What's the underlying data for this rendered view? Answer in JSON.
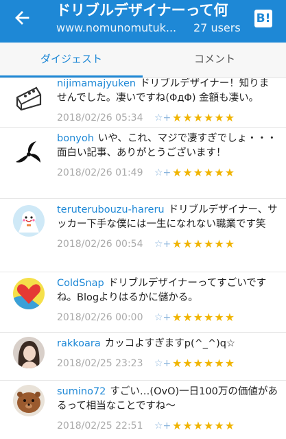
{
  "header": {
    "title": "ドリブルデザイナーって何",
    "domain": "www.nomunomutuk...",
    "users": "27 users",
    "logo": "B!"
  },
  "tabs": [
    {
      "label": "ダイジェスト",
      "active": true
    },
    {
      "label": "コメント",
      "active": false
    }
  ],
  "colors": {
    "accent": "#1e88d6",
    "star": "#f0b400"
  },
  "comments": [
    {
      "user": "nijimamajyuken",
      "text": "ドリブルデザイナー！知りませんでした。凄いですね(ΦдΦ) 金額も凄い。",
      "date": "2018/02/26 05:34",
      "stars": "★★★★★★",
      "avatar_icon": "cake-icon"
    },
    {
      "user": "bonyoh",
      "text": "いや、これ、マジで凄すぎでしょ・・・面白い記事、ありがとうございます！",
      "date": "2018/02/26 01:49",
      "stars": "★★★★★★",
      "avatar_icon": "tomoe-icon"
    },
    {
      "user": "teruterubouzu-hareru",
      "text": "ドリブルデザイナー、サッカー下手な僕には一生になれない職業です笑",
      "date": "2018/02/26 00:54",
      "stars": "★★★★★★",
      "avatar_icon": "teru-teru-bozu-icon"
    },
    {
      "user": "ColdSnap",
      "text": "ドリブルデザイナーってすごいですね。Blogよりはるかに儲かる。",
      "date": "2018/02/26 00:00",
      "stars": "★★★★★★",
      "avatar_icon": "heart-icon"
    },
    {
      "user": "rakkoara",
      "text": "カッコよすぎますp(^_^)q☆",
      "date": "2018/02/25 23:23",
      "stars": "★★★★★★",
      "avatar_icon": "user-photo-icon"
    },
    {
      "user": "sumino72",
      "text": "すごい…(OvO)一日100万の価値があるって相当なことですね〜",
      "date": "2018/02/25 22:51",
      "stars": "★★★★★★",
      "avatar_icon": "otter-icon"
    }
  ],
  "star_add_label": "☆+"
}
